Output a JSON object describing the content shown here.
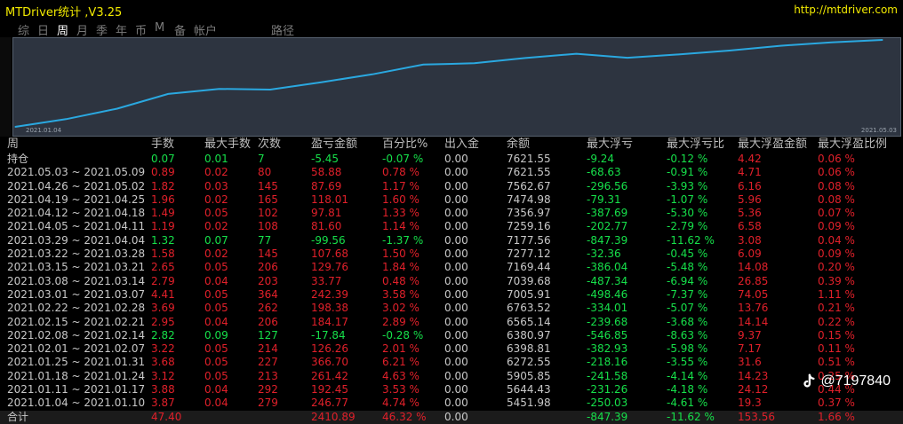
{
  "app": {
    "title": "MTDriver统计 ,V3.25",
    "url": "http://mtdriver.com"
  },
  "tabs": [
    {
      "label": "综",
      "active": false
    },
    {
      "label": "日",
      "active": false
    },
    {
      "label": "周",
      "active": true
    },
    {
      "label": "月",
      "active": false
    },
    {
      "label": "季",
      "active": false
    },
    {
      "label": "年",
      "active": false
    },
    {
      "label": "币",
      "active": false
    },
    {
      "label": "M",
      "active": false
    },
    {
      "label": "备",
      "active": false
    },
    {
      "label": "帐户",
      "active": false
    },
    {
      "label": "路径",
      "active": false
    }
  ],
  "chart": {
    "start_label": "2021.01.04",
    "end_label": "2021.05.03",
    "line_color": "#2aa8e0",
    "background": "#2d3440"
  },
  "chart_data": {
    "type": "line",
    "x": [
      "2021.01.04",
      "2021.01.11",
      "2021.01.18",
      "2021.01.25",
      "2021.02.01",
      "2021.02.08",
      "2021.02.15",
      "2021.02.22",
      "2021.03.01",
      "2021.03.08",
      "2021.03.15",
      "2021.03.22",
      "2021.03.29",
      "2021.04.05",
      "2021.04.12",
      "2021.04.19",
      "2021.04.26",
      "2021.05.03"
    ],
    "series": [
      {
        "values": [
          5451.98,
          5644.43,
          5905.85,
          6272.55,
          6398.81,
          6380.97,
          6565.14,
          6763.52,
          7005.91,
          7039.68,
          7169.44,
          7277.12,
          7177.56,
          7259.16,
          7356.97,
          7474.98,
          7562.67,
          7621.55
        ]
      }
    ],
    "xlabel": "",
    "ylabel": ""
  },
  "table": {
    "headers": [
      "周",
      "手数",
      "最大手数",
      "次数",
      "盈亏金额",
      "百分比%",
      "出入金",
      "余额",
      "最大浮亏",
      "最大浮亏比",
      "最大浮盈金额",
      "最大浮盈比例"
    ],
    "holding": {
      "label": "持仓",
      "lots": "0.07",
      "max_lots": "0.01",
      "count": "7",
      "pnl": "-5.45",
      "pct": "-0.07 %",
      "io": "0.00",
      "balance": "7621.55",
      "max_dd": "-9.24",
      "max_dd_pct": "-0.12 %",
      "max_fp": "4.42",
      "max_fp_pct": "0.06 %"
    },
    "rows": [
      {
        "week": "2021.05.03 ~ 2021.05.09",
        "lots": "0.89",
        "max_lots": "0.02",
        "count": "80",
        "pnl": "58.88",
        "pct": "0.78 %",
        "io": "0.00",
        "balance": "7621.55",
        "max_dd": "-68.63",
        "max_dd_pct": "-0.91 %",
        "max_fp": "4.71",
        "max_fp_pct": "0.06 %"
      },
      {
        "week": "2021.04.26 ~ 2021.05.02",
        "lots": "1.82",
        "max_lots": "0.03",
        "count": "145",
        "pnl": "87.69",
        "pct": "1.17 %",
        "io": "0.00",
        "balance": "7562.67",
        "max_dd": "-296.56",
        "max_dd_pct": "-3.93 %",
        "max_fp": "6.16",
        "max_fp_pct": "0.08 %"
      },
      {
        "week": "2021.04.19 ~ 2021.04.25",
        "lots": "1.96",
        "max_lots": "0.02",
        "count": "165",
        "pnl": "118.01",
        "pct": "1.60 %",
        "io": "0.00",
        "balance": "7474.98",
        "max_dd": "-79.31",
        "max_dd_pct": "-1.07 %",
        "max_fp": "5.96",
        "max_fp_pct": "0.08 %"
      },
      {
        "week": "2021.04.12 ~ 2021.04.18",
        "lots": "1.49",
        "max_lots": "0.05",
        "count": "102",
        "pnl": "97.81",
        "pct": "1.33 %",
        "io": "0.00",
        "balance": "7356.97",
        "max_dd": "-387.69",
        "max_dd_pct": "-5.30 %",
        "max_fp": "5.36",
        "max_fp_pct": "0.07 %"
      },
      {
        "week": "2021.04.05 ~ 2021.04.11",
        "lots": "1.19",
        "max_lots": "0.02",
        "count": "108",
        "pnl": "81.60",
        "pct": "1.14 %",
        "io": "0.00",
        "balance": "7259.16",
        "max_dd": "-202.77",
        "max_dd_pct": "-2.79 %",
        "max_fp": "6.58",
        "max_fp_pct": "0.09 %"
      },
      {
        "week": "2021.03.29 ~ 2021.04.04",
        "lots": "1.32",
        "max_lots": "0.07",
        "count": "77",
        "pnl": "-99.56",
        "pct": "-1.37 %",
        "io": "0.00",
        "balance": "7177.56",
        "max_dd": "-847.39",
        "max_dd_pct": "-11.62 %",
        "max_fp": "3.08",
        "max_fp_pct": "0.04 %"
      },
      {
        "week": "2021.03.22 ~ 2021.03.28",
        "lots": "1.58",
        "max_lots": "0.02",
        "count": "145",
        "pnl": "107.68",
        "pct": "1.50 %",
        "io": "0.00",
        "balance": "7277.12",
        "max_dd": "-32.36",
        "max_dd_pct": "-0.45 %",
        "max_fp": "6.09",
        "max_fp_pct": "0.09 %"
      },
      {
        "week": "2021.03.15 ~ 2021.03.21",
        "lots": "2.65",
        "max_lots": "0.05",
        "count": "206",
        "pnl": "129.76",
        "pct": "1.84 %",
        "io": "0.00",
        "balance": "7169.44",
        "max_dd": "-386.04",
        "max_dd_pct": "-5.48 %",
        "max_fp": "14.08",
        "max_fp_pct": "0.20 %"
      },
      {
        "week": "2021.03.08 ~ 2021.03.14",
        "lots": "2.79",
        "max_lots": "0.04",
        "count": "203",
        "pnl": "33.77",
        "pct": "0.48 %",
        "io": "0.00",
        "balance": "7039.68",
        "max_dd": "-487.34",
        "max_dd_pct": "-6.94 %",
        "max_fp": "26.85",
        "max_fp_pct": "0.39 %"
      },
      {
        "week": "2021.03.01 ~ 2021.03.07",
        "lots": "4.41",
        "max_lots": "0.05",
        "count": "364",
        "pnl": "242.39",
        "pct": "3.58 %",
        "io": "0.00",
        "balance": "7005.91",
        "max_dd": "-498.46",
        "max_dd_pct": "-7.37 %",
        "max_fp": "74.05",
        "max_fp_pct": "1.11 %"
      },
      {
        "week": "2021.02.22 ~ 2021.02.28",
        "lots": "3.69",
        "max_lots": "0.05",
        "count": "262",
        "pnl": "198.38",
        "pct": "3.02 %",
        "io": "0.00",
        "balance": "6763.52",
        "max_dd": "-334.01",
        "max_dd_pct": "-5.07 %",
        "max_fp": "13.76",
        "max_fp_pct": "0.21 %"
      },
      {
        "week": "2021.02.15 ~ 2021.02.21",
        "lots": "2.95",
        "max_lots": "0.04",
        "count": "206",
        "pnl": "184.17",
        "pct": "2.89 %",
        "io": "0.00",
        "balance": "6565.14",
        "max_dd": "-239.68",
        "max_dd_pct": "-3.68 %",
        "max_fp": "14.14",
        "max_fp_pct": "0.22 %"
      },
      {
        "week": "2021.02.08 ~ 2021.02.14",
        "lots": "2.82",
        "max_lots": "0.09",
        "count": "127",
        "pnl": "-17.84",
        "pct": "-0.28 %",
        "io": "0.00",
        "balance": "6380.97",
        "max_dd": "-546.85",
        "max_dd_pct": "-8.63 %",
        "max_fp": "9.37",
        "max_fp_pct": "0.15 %"
      },
      {
        "week": "2021.02.01 ~ 2021.02.07",
        "lots": "3.22",
        "max_lots": "0.05",
        "count": "214",
        "pnl": "126.26",
        "pct": "2.01 %",
        "io": "0.00",
        "balance": "6398.81",
        "max_dd": "-382.93",
        "max_dd_pct": "-5.98 %",
        "max_fp": "7.17",
        "max_fp_pct": "0.11 %"
      },
      {
        "week": "2021.01.25 ~ 2021.01.31",
        "lots": "3.68",
        "max_lots": "0.05",
        "count": "227",
        "pnl": "366.70",
        "pct": "6.21 %",
        "io": "0.00",
        "balance": "6272.55",
        "max_dd": "-218.16",
        "max_dd_pct": "-3.55 %",
        "max_fp": "31.6",
        "max_fp_pct": "0.51 %"
      },
      {
        "week": "2021.01.18 ~ 2021.01.24",
        "lots": "3.12",
        "max_lots": "0.05",
        "count": "213",
        "pnl": "261.42",
        "pct": "4.63 %",
        "io": "0.00",
        "balance": "5905.85",
        "max_dd": "-241.58",
        "max_dd_pct": "-4.14 %",
        "max_fp": "14.23",
        "max_fp_pct": "0.25 %"
      },
      {
        "week": "2021.01.11 ~ 2021.01.17",
        "lots": "3.88",
        "max_lots": "0.04",
        "count": "292",
        "pnl": "192.45",
        "pct": "3.53 %",
        "io": "0.00",
        "balance": "5644.43",
        "max_dd": "-231.26",
        "max_dd_pct": "-4.18 %",
        "max_fp": "24.12",
        "max_fp_pct": "0.44 %"
      },
      {
        "week": "2021.01.04 ~ 2021.01.10",
        "lots": "3.87",
        "max_lots": "0.04",
        "count": "279",
        "pnl": "246.77",
        "pct": "4.74 %",
        "io": "0.00",
        "balance": "5451.98",
        "max_dd": "-250.03",
        "max_dd_pct": "-4.61 %",
        "max_fp": "19.3",
        "max_fp_pct": "0.37 %"
      }
    ],
    "total": {
      "label": "合计",
      "lots": "47.40",
      "max_lots": "",
      "count": "",
      "pnl": "2410.89",
      "pct": "46.32 %",
      "io": "0.00",
      "balance": "",
      "max_dd": "-847.39",
      "max_dd_pct": "-11.62 %",
      "max_fp": "153.56",
      "max_fp_pct": "1.66 %"
    }
  },
  "watermark": {
    "text": "@7197840"
  },
  "colors": {
    "profit": "#e0202a",
    "loss": "#16e04a",
    "title": "#f2ea00"
  }
}
